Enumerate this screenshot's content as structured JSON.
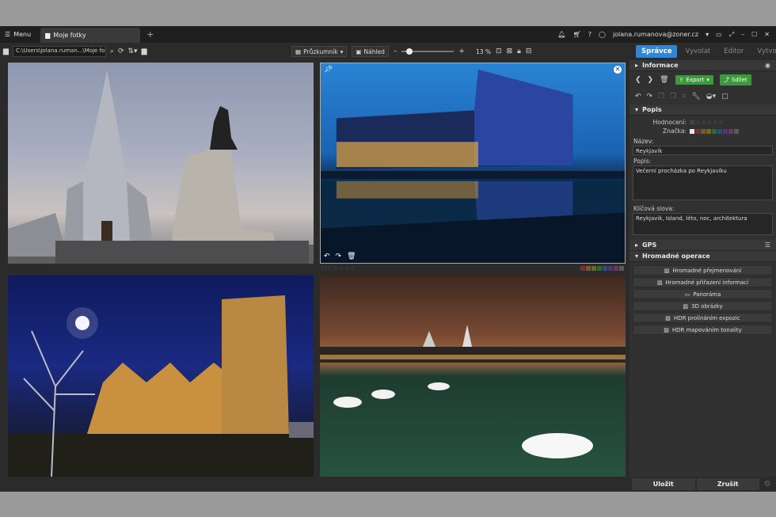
{
  "titlebar": {
    "menu_label": "Menu",
    "tab_label": "Moje fotky",
    "add_tab": "+",
    "account": "jolana.rumanova@zoner.cz"
  },
  "toolbar": {
    "path": "C:\\Users\\jolana.ruman...\\Moje fotky",
    "browser_label": "Průzkumník",
    "preview_label": "Náhled",
    "zoom": "13 %",
    "zoom_fraction": 0.13
  },
  "modules": {
    "manager": "Správce",
    "develop": "Vyvolat",
    "editor": "Editor",
    "create": "Vytvořit"
  },
  "panel": {
    "info_header": "Informace",
    "export_label": "Export",
    "share_label": "Sdílet",
    "popis_header": "Popis",
    "rating_label": "Hodnocení:",
    "tag_label": "Značka:",
    "name_label": "Název:",
    "name_value": "Reykjavík",
    "desc_label": "Popis:",
    "desc_value": "Večerní procházka po Reykjavíku",
    "keywords_label": "Klíčová slova:",
    "keywords_value": "Reykjavík, Island, léto, noc, architektura",
    "gps_header": "GPS",
    "batch_header": "Hromadné operace",
    "ops": [
      "Hromadné přejmenování",
      "Hromadné přiřazení informací",
      "Panoráma",
      "3D obrázky",
      "HDR prolínáním expozic",
      "HDR mapováním tonality"
    ],
    "save": "Uložit",
    "cancel": "Zrušit"
  },
  "colors": {
    "accent": "#2f86d6",
    "green": "#3c9a3c",
    "tag_swatches": [
      "#7a3030",
      "#7a5a20",
      "#6a6a2a",
      "#2f6a2f",
      "#2a4f7a",
      "#4a3a7a",
      "#6a3a5a",
      "#5a5a5a"
    ]
  }
}
